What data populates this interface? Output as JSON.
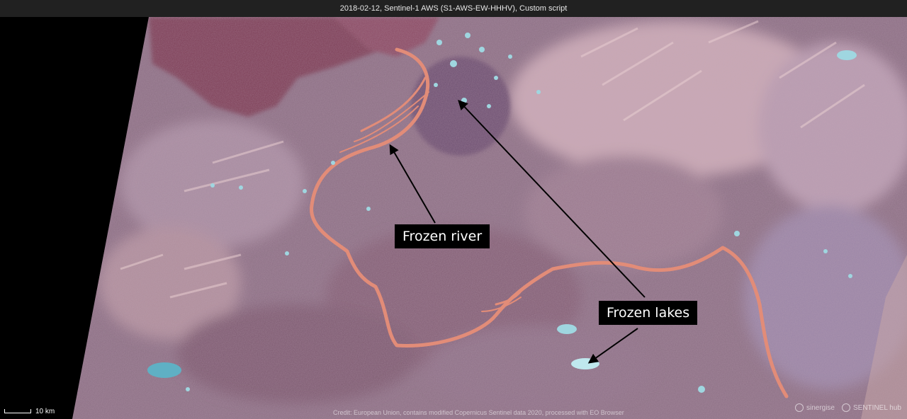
{
  "header": {
    "title": "2018-02-12, Sentinel-1 AWS (S1-AWS-EW-HHHV), Custom script"
  },
  "annotations": {
    "river_label": "Frozen river",
    "lakes_label": "Frozen lakes"
  },
  "scale": {
    "label": "10 km"
  },
  "footer": {
    "credit": "Credit: European Union, contains modified Copernicus Sentinel data 2020, processed with EO Browser",
    "logo_1": "sinergise",
    "logo_2": "SENTINEL hub"
  },
  "colors": {
    "terrain": "#8a6e82",
    "water_dark": "#7a3a50",
    "river_ice": "#e08a78",
    "lake_ice": "#a8e0e8",
    "label_bg": "#000000",
    "label_text": "#ffffff",
    "arrow": "#000000"
  }
}
